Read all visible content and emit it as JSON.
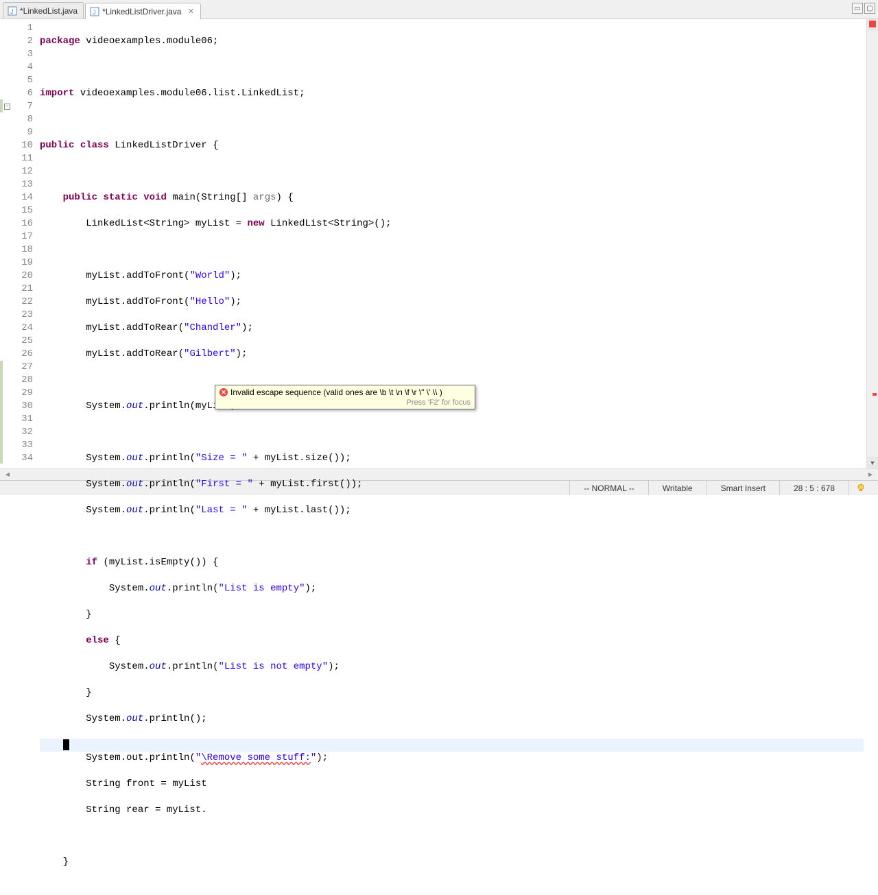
{
  "tabs": [
    {
      "label": "*LinkedList.java",
      "active": false
    },
    {
      "label": "*LinkedListDriver.java",
      "active": true
    }
  ],
  "lines": {
    "count": 34,
    "folds": [
      7
    ],
    "errors": [
      29
    ],
    "current": 28
  },
  "code": {
    "l1_package": "package",
    "l1_pkg": " videoexamples.module06;",
    "l3_import": "import",
    "l3_rest": " videoexamples.module06.list.LinkedList;",
    "l5_public": "public",
    "l5_class": "class",
    "l5_name": " LinkedListDriver {",
    "l7_public": "public",
    "l7_static": "static",
    "l7_void": "void",
    "l7_main": " main(String[] ",
    "l7_args": "args",
    "l7_end": ") {",
    "l8_a": "        LinkedList<String> myList = ",
    "l8_new": "new",
    "l8_b": " LinkedList<String>();",
    "l10": "        myList.addToFront(",
    "l10s": "\"World\"",
    "l10e": ");",
    "l11": "        myList.addToFront(",
    "l11s": "\"Hello\"",
    "l11e": ");",
    "l12": "        myList.addToRear(",
    "l12s": "\"Chandler\"",
    "l12e": ");",
    "l13": "        myList.addToRear(",
    "l13s": "\"Gilbert\"",
    "l13e": ");",
    "l15a": "        System.",
    "out": "out",
    "l15b": ".println(myList);",
    "l17b": ".println(",
    "l17s": "\"Size = \"",
    "l17c": " + myList.size());",
    "l18s": "\"First = \"",
    "l18c": " + myList.first());",
    "l19s": "\"Last = \"",
    "l19c": " + myList.last());",
    "l21a": "        ",
    "l21if": "if",
    "l21b": " (myList.isEmpty()) {",
    "l22a": "            System.",
    "l22s": "\"List is empty\"",
    "l22e": ");",
    "l23": "        }",
    "l24a": "        ",
    "l24else": "else",
    "l24b": " {",
    "l25s": "\"List is not empty\"",
    "l26": "        }",
    "l27b": ".println();",
    "l29a": "        System.out.println(",
    "l29s1": "\"",
    "l29err": "\\Remove some stuff:",
    "l29s2": "\"",
    "l29e": ");",
    "l30": "        String front = myList",
    "l31": "        String rear = myList.",
    "l33": "    }"
  },
  "tooltip": {
    "message": "Invalid escape sequence (valid ones are  \\b  \\t  \\n  \\f  \\r  \\\"  \\'  \\\\ )",
    "hint": "Press 'F2' for focus"
  },
  "status": {
    "mode": "-- NORMAL --",
    "writable": "Writable",
    "insert": "Smart Insert",
    "pos": "28 : 5 : 678"
  }
}
